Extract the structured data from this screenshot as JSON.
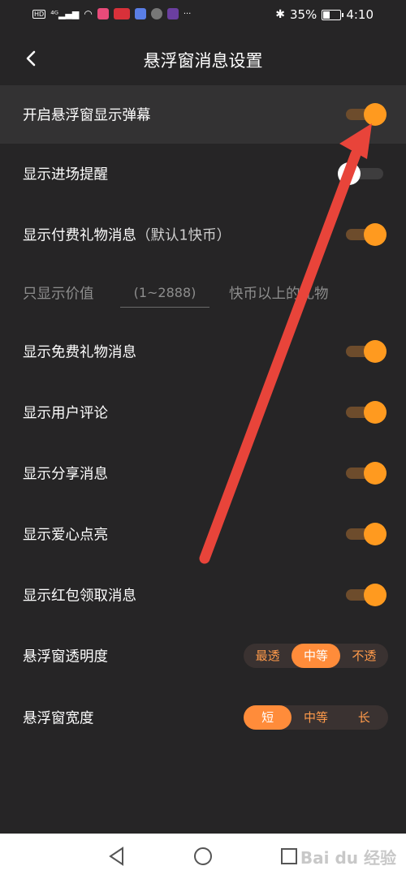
{
  "status_bar": {
    "left_icons": [
      "hd-icon",
      "4g-signal-icon",
      "wifi-icon",
      "app-icon-1",
      "app-icon-2",
      "app-icon-3",
      "app-icon-4",
      "app-icon-5"
    ],
    "more": "···",
    "battery": "35%",
    "time": "4:10"
  },
  "header": {
    "title": "悬浮窗消息设置"
  },
  "settings": [
    {
      "label": "开启悬浮窗显示弹幕",
      "on": true
    },
    {
      "label": "显示进场提醒",
      "on": false
    },
    {
      "label": "显示付费礼物消息",
      "hint": "（默认1快币）",
      "on": true
    }
  ],
  "value_row": {
    "prefix": "只显示价值",
    "placeholder": "(1~2888)",
    "suffix": "快币以上的礼物"
  },
  "settings2": [
    {
      "label": "显示免费礼物消息",
      "on": true
    },
    {
      "label": "显示用户评论",
      "on": true
    },
    {
      "label": "显示分享消息",
      "on": true
    },
    {
      "label": "显示爱心点亮",
      "on": true
    },
    {
      "label": "显示红包领取消息",
      "on": true
    }
  ],
  "transparency": {
    "label": "悬浮窗透明度",
    "options": [
      "最透",
      "中等",
      "不透"
    ],
    "selected": "中等"
  },
  "width": {
    "label": "悬浮窗宽度",
    "options": [
      "短",
      "中等",
      "长"
    ],
    "selected": "短"
  },
  "watermark": "Bai du 经验",
  "colors": {
    "accent": "#ff9a1f",
    "segment_active": "#ff8c3a",
    "annotation_arrow": "#e8443a",
    "background": "#262526"
  }
}
